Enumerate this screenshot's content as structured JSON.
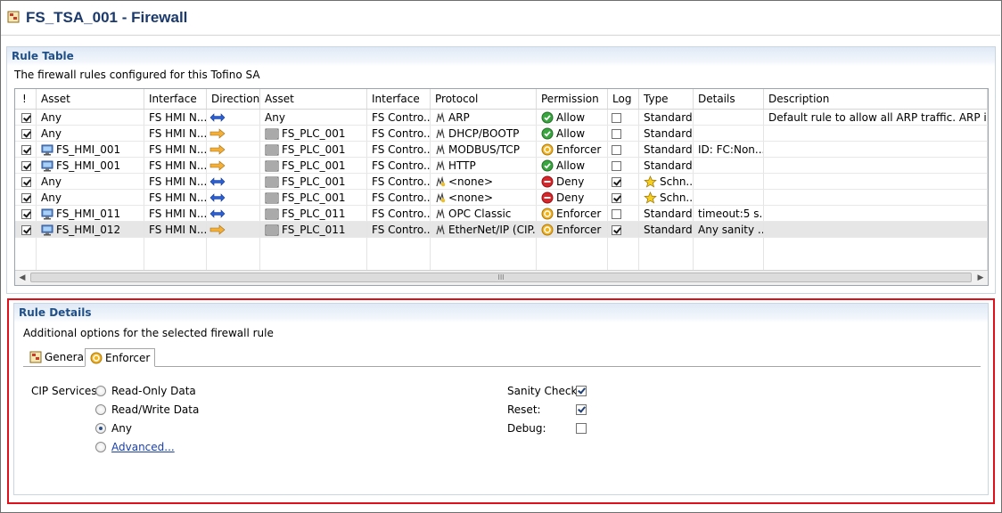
{
  "editor": {
    "title": "FS_TSA_001 - Firewall"
  },
  "rule_table": {
    "title": "Rule Table",
    "description": "The firewall rules configured for this Tofino SA",
    "columns": [
      "!",
      "Asset",
      "Interface",
      "Direction",
      "Asset",
      "Interface",
      "Protocol",
      "Permission",
      "Log",
      "Type",
      "Details",
      "Description"
    ],
    "rows": [
      {
        "enabled": true,
        "src_asset": "Any",
        "src_icon": "",
        "src_if": "FS HMI N...",
        "direction": "both",
        "dst_asset": "Any",
        "dst_icon": "",
        "dst_if": "FS Contro...",
        "protocol": "ARP",
        "permission": "Allow",
        "perm_icon": "allow",
        "log": false,
        "type": "Standard",
        "type_icon": "",
        "details": "",
        "description": "Default rule to allow all ARP traffic. ARP is n..."
      },
      {
        "enabled": true,
        "src_asset": "Any",
        "src_icon": "",
        "src_if": "FS HMI N...",
        "direction": "right",
        "dst_asset": "FS_PLC_001",
        "dst_icon": "plc",
        "dst_if": "FS Contro...",
        "protocol": "DHCP/BOOTP",
        "permission": "Allow",
        "perm_icon": "allow",
        "log": false,
        "type": "Standard",
        "type_icon": "",
        "details": "",
        "description": ""
      },
      {
        "enabled": true,
        "src_asset": "FS_HMI_001",
        "src_icon": "hmi",
        "src_if": "FS HMI N...",
        "direction": "right",
        "dst_asset": "FS_PLC_001",
        "dst_icon": "plc",
        "dst_if": "FS Contro...",
        "protocol": "MODBUS/TCP",
        "permission": "Enforcer",
        "perm_icon": "enforcer",
        "log": false,
        "type": "Standard",
        "type_icon": "",
        "details": "ID: FC:Non...",
        "description": ""
      },
      {
        "enabled": true,
        "src_asset": "FS_HMI_001",
        "src_icon": "hmi",
        "src_if": "FS HMI N...",
        "direction": "right",
        "dst_asset": "FS_PLC_001",
        "dst_icon": "plc",
        "dst_if": "FS Contro...",
        "protocol": "HTTP",
        "permission": "Allow",
        "perm_icon": "allow",
        "log": false,
        "type": "Standard",
        "type_icon": "",
        "details": "",
        "description": ""
      },
      {
        "enabled": true,
        "src_asset": "Any",
        "src_icon": "",
        "src_if": "FS HMI N...",
        "direction": "both",
        "dst_asset": "FS_PLC_001",
        "dst_icon": "plc",
        "dst_if": "FS Contro...",
        "protocol": "<none>",
        "permission": "Deny",
        "perm_icon": "deny",
        "log": true,
        "type": "Schn...",
        "type_icon": "star",
        "details": "",
        "description": ""
      },
      {
        "enabled": true,
        "src_asset": "Any",
        "src_icon": "",
        "src_if": "FS HMI N...",
        "direction": "both",
        "dst_asset": "FS_PLC_001",
        "dst_icon": "plc",
        "dst_if": "FS Contro...",
        "protocol": "<none>",
        "permission": "Deny",
        "perm_icon": "deny",
        "log": true,
        "type": "Schn...",
        "type_icon": "star",
        "details": "",
        "description": ""
      },
      {
        "enabled": true,
        "src_asset": "FS_HMI_011",
        "src_icon": "hmi",
        "src_if": "FS HMI N...",
        "direction": "both",
        "dst_asset": "FS_PLC_011",
        "dst_icon": "plc",
        "dst_if": "FS Contro...",
        "protocol": "OPC Classic",
        "permission": "Enforcer",
        "perm_icon": "enforcer",
        "log": false,
        "type": "Standard",
        "type_icon": "",
        "details": "timeout:5 s...",
        "description": ""
      },
      {
        "enabled": true,
        "src_asset": "FS_HMI_012",
        "src_icon": "hmi",
        "src_if": "FS HMI N...",
        "direction": "right",
        "dst_asset": "FS_PLC_011",
        "dst_icon": "plc",
        "dst_if": "FS Contro...",
        "protocol": "EtherNet/IP (CIP...",
        "permission": "Enforcer",
        "perm_icon": "enforcer",
        "log": true,
        "type": "Standard",
        "type_icon": "",
        "details": "Any sanity ...",
        "description": "",
        "selected": true
      }
    ],
    "scroll_thumb": "III"
  },
  "rule_details": {
    "title": "Rule Details",
    "description": "Additional options for the selected firewall rule",
    "tabs": [
      "General",
      "Enforcer"
    ],
    "active_tab": "Enforcer",
    "cip_label": "CIP Services:",
    "cip_options": [
      {
        "label": "Read-Only Data",
        "selected": false
      },
      {
        "label": "Read/Write Data",
        "selected": false
      },
      {
        "label": "Any",
        "selected": true
      },
      {
        "label": "Advanced...",
        "selected": false,
        "link": true
      }
    ],
    "checks": [
      {
        "label": "Sanity Check:",
        "checked": true
      },
      {
        "label": "Reset:",
        "checked": true
      },
      {
        "label": "Debug:",
        "checked": false
      }
    ]
  },
  "colors": {
    "accent_title": "#1f4f86",
    "highlight_frame": "#e0101a",
    "allow": "#3aa640",
    "deny": "#d8262b",
    "enforcer": "#e0a020",
    "arrow_both": "#2a5fd6",
    "arrow_right": "#e3a32a"
  }
}
